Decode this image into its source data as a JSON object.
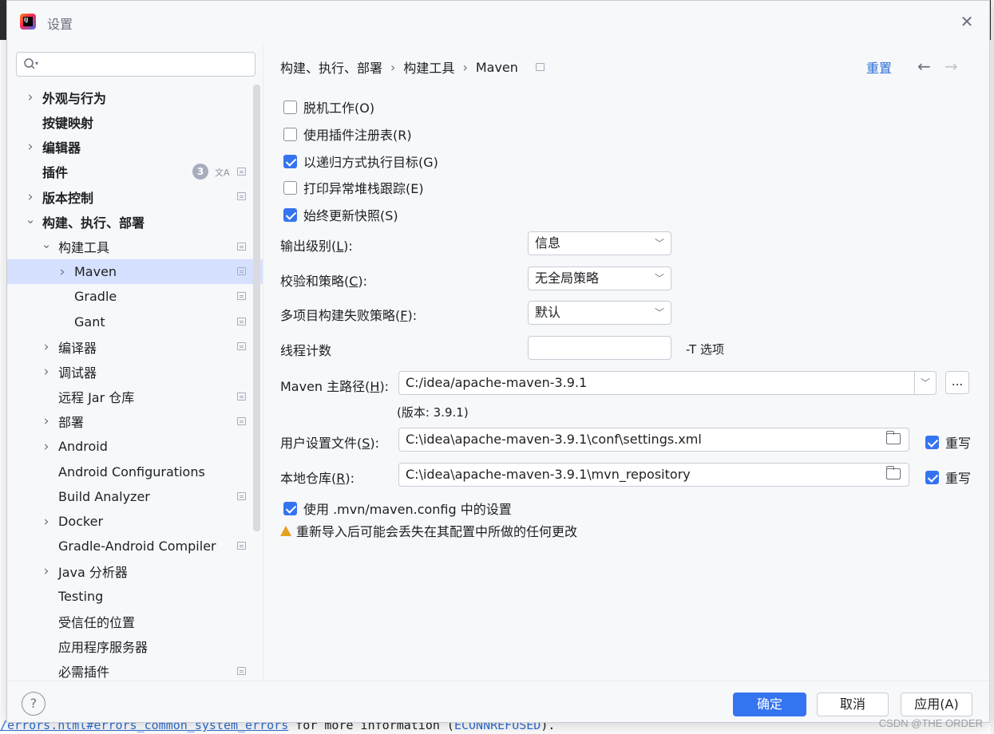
{
  "window": {
    "title": "设置"
  },
  "search": {
    "placeholder": ""
  },
  "tree": [
    {
      "label": "外观与行为",
      "bold": true,
      "chevron": "right",
      "indent": 0,
      "proj": false
    },
    {
      "label": "按键映射",
      "bold": true,
      "chevron": "",
      "indent": 0,
      "proj": false
    },
    {
      "label": "编辑器",
      "bold": true,
      "chevron": "right",
      "indent": 0,
      "proj": false
    },
    {
      "label": "插件",
      "bold": true,
      "chevron": "",
      "indent": 0,
      "proj": true,
      "badge": "3"
    },
    {
      "label": "版本控制",
      "bold": true,
      "chevron": "right",
      "indent": 0,
      "proj": true
    },
    {
      "label": "构建、执行、部署",
      "bold": true,
      "chevron": "down",
      "indent": 0,
      "proj": false
    },
    {
      "label": "构建工具",
      "bold": false,
      "chevron": "down",
      "indent": 1,
      "proj": true
    },
    {
      "label": "Maven",
      "bold": false,
      "chevron": "right",
      "indent": 2,
      "proj": true,
      "selected": true
    },
    {
      "label": "Gradle",
      "bold": false,
      "chevron": "",
      "indent": 2,
      "proj": true
    },
    {
      "label": "Gant",
      "bold": false,
      "chevron": "",
      "indent": 2,
      "proj": true
    },
    {
      "label": "编译器",
      "bold": false,
      "chevron": "right",
      "indent": 1,
      "proj": true
    },
    {
      "label": "调试器",
      "bold": false,
      "chevron": "right",
      "indent": 1,
      "proj": false
    },
    {
      "label": "远程 Jar 仓库",
      "bold": false,
      "chevron": "",
      "indent": 1,
      "proj": true
    },
    {
      "label": "部署",
      "bold": false,
      "chevron": "right",
      "indent": 1,
      "proj": true
    },
    {
      "label": "Android",
      "bold": false,
      "chevron": "right",
      "indent": 1,
      "proj": false
    },
    {
      "label": "Android Configurations",
      "bold": false,
      "chevron": "",
      "indent": 1,
      "proj": false
    },
    {
      "label": "Build Analyzer",
      "bold": false,
      "chevron": "",
      "indent": 1,
      "proj": true
    },
    {
      "label": "Docker",
      "bold": false,
      "chevron": "right",
      "indent": 1,
      "proj": false
    },
    {
      "label": "Gradle-Android Compiler",
      "bold": false,
      "chevron": "",
      "indent": 1,
      "proj": true
    },
    {
      "label": "Java 分析器",
      "bold": false,
      "chevron": "right",
      "indent": 1,
      "proj": false
    },
    {
      "label": "Testing",
      "bold": false,
      "chevron": "",
      "indent": 1,
      "proj": false
    },
    {
      "label": "受信任的位置",
      "bold": false,
      "chevron": "",
      "indent": 1,
      "proj": false
    },
    {
      "label": "应用程序服务器",
      "bold": false,
      "chevron": "",
      "indent": 1,
      "proj": false
    },
    {
      "label": "必需插件",
      "bold": false,
      "chevron": "",
      "indent": 1,
      "proj": true
    }
  ],
  "breadcrumb": {
    "items": [
      "构建、执行、部署",
      "构建工具",
      "Maven"
    ],
    "sep": "›"
  },
  "header": {
    "reset": "重置"
  },
  "checkboxes": [
    {
      "label": "脱机工作(O)",
      "checked": false
    },
    {
      "label": "使用插件注册表(R)",
      "checked": false
    },
    {
      "label": "以递归方式执行目标(G)",
      "checked": true
    },
    {
      "label": "打印异常堆栈跟踪(E)",
      "checked": false
    },
    {
      "label": "始终更新快照(S)",
      "checked": true
    }
  ],
  "output_level": {
    "label_pre": "输出级别(",
    "key": "L",
    "label_post": "):",
    "value": "信息"
  },
  "checksum": {
    "label_pre": "校验和策略(",
    "key": "C",
    "label_post": "):",
    "value": "无全局策略"
  },
  "multiproject": {
    "label_pre": "多项目构建失败策略(",
    "key": "F",
    "label_post": "):",
    "value": "默认"
  },
  "threads": {
    "label": "线程计数",
    "value": "",
    "hint": "-T 选项"
  },
  "maven_home": {
    "label_pre": "Maven 主路径(",
    "key": "H",
    "label_post": "):",
    "value": "C:/idea/apache-maven-3.9.1",
    "version": "(版本: 3.9.1)",
    "browse": "..."
  },
  "user_settings": {
    "label_pre": "用户设置文件(",
    "key": "S",
    "label_post": "):",
    "value": "C:\\idea\\apache-maven-3.9.1\\conf\\settings.xml",
    "override": "重写",
    "override_checked": true
  },
  "local_repo": {
    "label_pre": "本地仓库(",
    "key": "R",
    "label_post": "):",
    "value": "C:\\idea\\apache-maven-3.9.1\\mvn_repository",
    "override": "重写",
    "override_checked": true
  },
  "use_mvn_config": {
    "label": "使用 .mvn/maven.config 中的设置",
    "checked": true
  },
  "warning": {
    "text": "重新导入后可能会丢失在其配置中所做的任何更改"
  },
  "footer": {
    "ok": "确定",
    "cancel": "取消",
    "apply": "应用(A)",
    "help": "?"
  },
  "background": {
    "code_prefix": "/errors.html#errors_common_system_errors",
    "code_mid": " for more information (",
    "code_err": "ECONNREFUSED",
    "code_end": ")."
  },
  "watermark": "CSDN @THE ORDER"
}
